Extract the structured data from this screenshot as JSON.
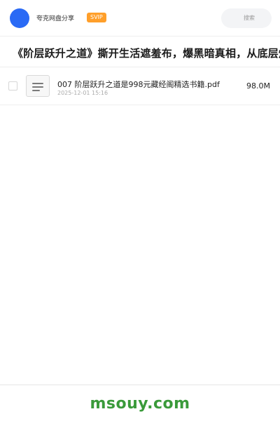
{
  "header": {
    "username": "夸克网盘分享",
    "badge": "SVIP",
    "search_placeholder": "搜索"
  },
  "share": {
    "title": "《阶层跃升之道》撕开生活遮羞布，爆黑暗真相，从底层炸"
  },
  "files": [
    {
      "name": "007 阶层跃升之道是998元藏经阁精选书籍.pdf",
      "date": "2025-12-01 15:16",
      "size": "98.0M"
    }
  ],
  "footer": {
    "watermark": "msouy.com"
  },
  "colors": {
    "avatar": "#2a6af5",
    "badge": "#ff9f2a",
    "watermark": "#3a9a3a"
  }
}
